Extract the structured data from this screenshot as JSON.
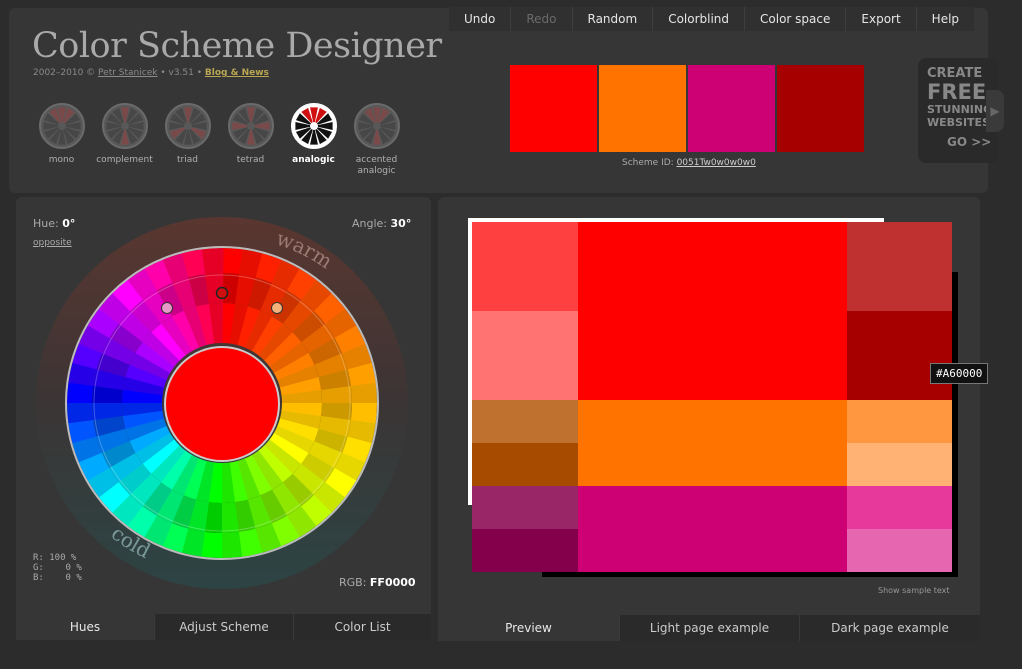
{
  "menu": [
    "Undo",
    "Redo",
    "Random",
    "Colorblind",
    "Color space",
    "Export",
    "Help"
  ],
  "menu_disabled": [
    "Redo"
  ],
  "header": {
    "title": "Color Scheme Designer",
    "copyright": "2002–2010 ©",
    "author": "Petr Stanicek",
    "version": "• v3.51 •",
    "blog": "Blog & News"
  },
  "modes": [
    {
      "id": "mono",
      "label": "mono"
    },
    {
      "id": "complement",
      "label": "complement"
    },
    {
      "id": "triad",
      "label": "triad"
    },
    {
      "id": "tetrad",
      "label": "tetrad"
    },
    {
      "id": "analogic",
      "label": "analogic",
      "active": true
    },
    {
      "id": "accented-analogic",
      "label": "accented analogic"
    }
  ],
  "swatches": [
    "#FF0000",
    "#FF7400",
    "#CD0074",
    "#A60000"
  ],
  "scheme": {
    "label": "Scheme ID:",
    "id": "0051Tw0w0w0w0"
  },
  "ad": {
    "l1": "CREATE",
    "l2": "FREE",
    "l3a": "STUNNING",
    "l3b": "WEBSITES",
    "go": "GO >>"
  },
  "wheel": {
    "hue_label": "Hue:",
    "hue_value": "0°",
    "opposite": "opposite",
    "angle_label": "Angle:",
    "angle_value": "30°",
    "rgb_pct": "R: 100 %\nG:    0 %\nB:    0 %",
    "rgb_label": "RGB:",
    "rgb_value": "FF0000",
    "warm": "warm",
    "cold": "cold"
  },
  "left_tabs": [
    "Hues",
    "Adjust Scheme",
    "Color List"
  ],
  "right_tabs": [
    "Preview",
    "Light page example",
    "Dark page example"
  ],
  "preview": {
    "primary": [
      "#FF4040",
      "#FF7373",
      "#FF0000",
      "#BF3030",
      "#A60000"
    ],
    "secondary_a": [
      "#BF7130",
      "#A64B00",
      "#FF7400",
      "#FF9640",
      "#FFB273"
    ],
    "secondary_b": [
      "#992667",
      "#85004B",
      "#CD0074",
      "#E6399B",
      "#E667AF"
    ]
  },
  "tooltip": "#A60000",
  "sample_text": "Show sample text"
}
